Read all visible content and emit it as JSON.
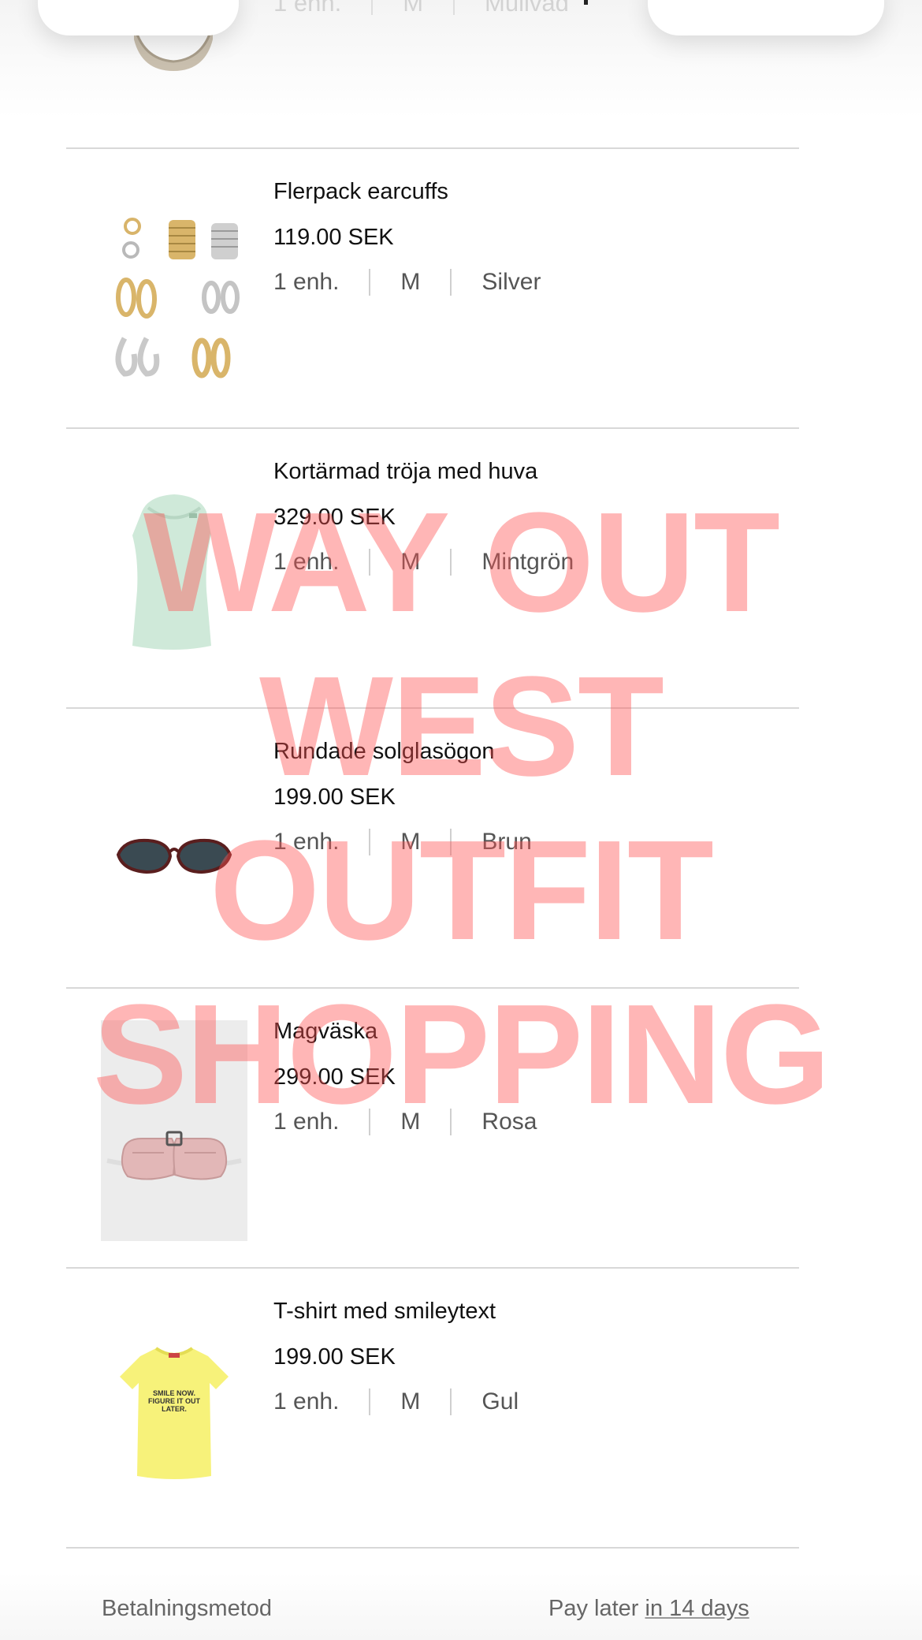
{
  "top_partial": {
    "qty": "1 enh.",
    "size": "M",
    "color": "Mullvad"
  },
  "items": [
    {
      "name": "Flerpack earcuffs",
      "price": "119.00 SEK",
      "qty": "1 enh.",
      "size": "M",
      "color": "Silver",
      "thumb": "earcuffs-icon"
    },
    {
      "name": "Kortärmad tröja med huva",
      "price": "329.00 SEK",
      "qty": "1 enh.",
      "size": "M",
      "color": "Mintgrön",
      "thumb": "hooded-top-icon"
    },
    {
      "name": "Rundade solglasögon",
      "price": "199.00 SEK",
      "qty": "1 enh.",
      "size": "M",
      "color": "Brun",
      "thumb": "sunglasses-icon"
    },
    {
      "name": "Magväska",
      "price": "299.00 SEK",
      "qty": "1 enh.",
      "size": "M",
      "color": "Rosa",
      "thumb": "belt-bag-icon"
    },
    {
      "name": "T-shirt med smileytext",
      "price": "199.00 SEK",
      "qty": "1 enh.",
      "size": "M",
      "color": "Gul",
      "thumb": "tshirt-icon",
      "print": "SMILE NOW. FIGURE IT OUT LATER."
    }
  ],
  "watermark_lines": [
    "WAY OUT",
    "WEST",
    "OUTFIT",
    "SHOPPING"
  ],
  "payment": {
    "label": "Betalningsmetod",
    "value_prefix": "Pay later ",
    "value_link": "in 14 days"
  }
}
